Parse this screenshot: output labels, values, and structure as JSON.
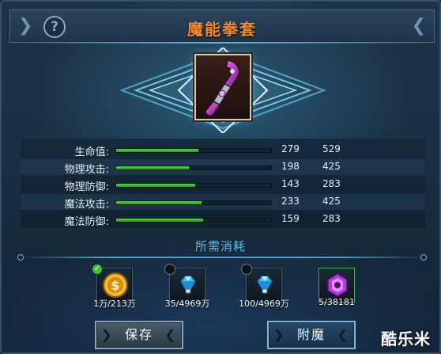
{
  "header": {
    "title": "魔能拳套",
    "help_glyph": "?"
  },
  "item": {
    "icon_name": "gauntlet-icon"
  },
  "stats": [
    {
      "label": "生命值:",
      "current": 279,
      "max": 529,
      "fill": 0.53
    },
    {
      "label": "物理攻击:",
      "current": 198,
      "max": 425,
      "fill": 0.47
    },
    {
      "label": "物理防御:",
      "current": 143,
      "max": 283,
      "fill": 0.51
    },
    {
      "label": "魔法攻击:",
      "current": 233,
      "max": 425,
      "fill": 0.55
    },
    {
      "label": "魔法防御:",
      "current": 159,
      "max": 283,
      "fill": 0.56
    }
  ],
  "cost": {
    "title": "所需消耗",
    "items": [
      {
        "icon": "gold-coin-icon",
        "amount": "1万/213万",
        "satisfied": true
      },
      {
        "icon": "diamond-icon",
        "amount": "35/4969万",
        "satisfied": false
      },
      {
        "icon": "diamond-icon",
        "amount": "100/4969万",
        "satisfied": false
      },
      {
        "icon": "purple-crystal-icon",
        "amount": "5/38181",
        "satisfied": false
      }
    ]
  },
  "buttons": {
    "save_label": "保存",
    "enchant_label": "附魔"
  },
  "watermark": "酷乐米",
  "colors": {
    "title": "#f28a2c",
    "bar_fill": "#3fc12f",
    "cost_title": "#62b9e6"
  }
}
